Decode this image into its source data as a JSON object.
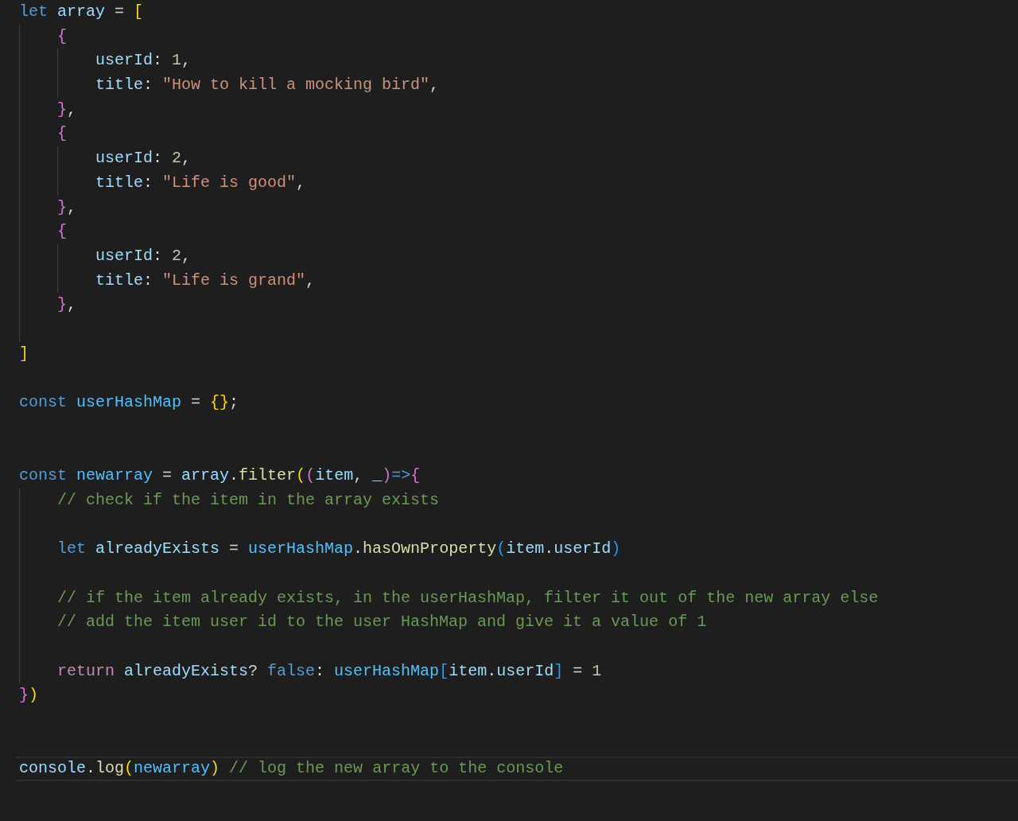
{
  "editor": {
    "lines": [
      {
        "kind": "code",
        "tokens": [
          {
            "kind": "keyword",
            "text": "let"
          },
          {
            "kind": "variable",
            "text": " array"
          },
          {
            "kind": "plain",
            "text": " = "
          },
          {
            "kind": "bracket_1",
            "text": "["
          }
        ],
        "children": [
          {
            "kind": "code",
            "tokens": [
              {
                "kind": "bracket_2",
                "text": "{"
              }
            ],
            "children": [
              {
                "kind": "code",
                "tokens": [
                  {
                    "kind": "variable",
                    "text": "userId"
                  },
                  {
                    "kind": "plain",
                    "text": ": "
                  },
                  {
                    "kind": "number",
                    "text": "1"
                  },
                  {
                    "kind": "plain",
                    "text": ","
                  }
                ]
              },
              {
                "kind": "code",
                "tokens": [
                  {
                    "kind": "variable",
                    "text": "title"
                  },
                  {
                    "kind": "plain",
                    "text": ": "
                  },
                  {
                    "kind": "string",
                    "text": "\"How to kill a mocking bird\""
                  },
                  {
                    "kind": "plain",
                    "text": ","
                  }
                ]
              }
            ]
          },
          {
            "kind": "code",
            "tokens": [
              {
                "kind": "bracket_2",
                "text": "}"
              },
              {
                "kind": "plain",
                "text": ","
              }
            ]
          },
          {
            "kind": "code",
            "tokens": [
              {
                "kind": "bracket_2",
                "text": "{"
              }
            ],
            "children": [
              {
                "kind": "code",
                "tokens": [
                  {
                    "kind": "variable",
                    "text": "userId"
                  },
                  {
                    "kind": "plain",
                    "text": ": "
                  },
                  {
                    "kind": "number",
                    "text": "2"
                  },
                  {
                    "kind": "plain",
                    "text": ","
                  }
                ]
              },
              {
                "kind": "code",
                "tokens": [
                  {
                    "kind": "variable",
                    "text": "title"
                  },
                  {
                    "kind": "plain",
                    "text": ": "
                  },
                  {
                    "kind": "string",
                    "text": "\"Life is good\""
                  },
                  {
                    "kind": "plain",
                    "text": ","
                  }
                ]
              }
            ]
          },
          {
            "kind": "code",
            "tokens": [
              {
                "kind": "bracket_2",
                "text": "}"
              },
              {
                "kind": "plain",
                "text": ","
              }
            ]
          },
          {
            "kind": "code",
            "tokens": [
              {
                "kind": "bracket_2",
                "text": "{"
              }
            ],
            "children": [
              {
                "kind": "code",
                "tokens": [
                  {
                    "kind": "variable",
                    "text": "userId"
                  },
                  {
                    "kind": "plain",
                    "text": ": "
                  },
                  {
                    "kind": "number",
                    "text": "2"
                  },
                  {
                    "kind": "plain",
                    "text": ","
                  }
                ]
              },
              {
                "kind": "code",
                "tokens": [
                  {
                    "kind": "variable",
                    "text": "title"
                  },
                  {
                    "kind": "plain",
                    "text": ": "
                  },
                  {
                    "kind": "string",
                    "text": "\"Life is grand\""
                  },
                  {
                    "kind": "plain",
                    "text": ","
                  }
                ]
              }
            ]
          },
          {
            "kind": "code",
            "tokens": [
              {
                "kind": "bracket_2",
                "text": "}"
              },
              {
                "kind": "plain",
                "text": ","
              }
            ]
          },
          {
            "kind": "blank"
          }
        ]
      },
      {
        "kind": "code",
        "tokens": [
          {
            "kind": "bracket_1",
            "text": "]"
          }
        ]
      },
      {
        "kind": "blank"
      },
      {
        "kind": "code",
        "tokens": [
          {
            "kind": "keyword",
            "text": "const"
          },
          {
            "kind": "constant",
            "text": " userHashMap"
          },
          {
            "kind": "plain",
            "text": " = "
          },
          {
            "kind": "bracket_1",
            "text": "{}"
          },
          {
            "kind": "plain",
            "text": ";"
          }
        ]
      },
      {
        "kind": "blank"
      },
      {
        "kind": "blank"
      },
      {
        "kind": "code",
        "tokens": [
          {
            "kind": "keyword",
            "text": "const"
          },
          {
            "kind": "constant",
            "text": " newarray"
          },
          {
            "kind": "plain",
            "text": " = "
          },
          {
            "kind": "variable",
            "text": "array"
          },
          {
            "kind": "plain",
            "text": "."
          },
          {
            "kind": "function",
            "text": "filter"
          },
          {
            "kind": "bracket_1",
            "text": "("
          },
          {
            "kind": "bracket_2",
            "text": "("
          },
          {
            "kind": "variable",
            "text": "item"
          },
          {
            "kind": "plain",
            "text": ", "
          },
          {
            "kind": "variable",
            "text": "_"
          },
          {
            "kind": "bracket_2",
            "text": ")"
          },
          {
            "kind": "keyword",
            "text": "=>"
          },
          {
            "kind": "bracket_2",
            "text": "{"
          }
        ],
        "children": [
          {
            "kind": "code",
            "tokens": [
              {
                "kind": "comment",
                "text": "// check if the item in the array exists"
              }
            ]
          },
          {
            "kind": "blank"
          },
          {
            "kind": "code",
            "tokens": [
              {
                "kind": "keyword",
                "text": "let"
              },
              {
                "kind": "variable",
                "text": " alreadyExists"
              },
              {
                "kind": "plain",
                "text": " = "
              },
              {
                "kind": "constant",
                "text": "userHashMap"
              },
              {
                "kind": "plain",
                "text": "."
              },
              {
                "kind": "function",
                "text": "hasOwnProperty"
              },
              {
                "kind": "bracket_3",
                "text": "("
              },
              {
                "kind": "variable",
                "text": "item"
              },
              {
                "kind": "plain",
                "text": "."
              },
              {
                "kind": "variable",
                "text": "userId"
              },
              {
                "kind": "bracket_3",
                "text": ")"
              }
            ]
          },
          {
            "kind": "blank"
          },
          {
            "kind": "code",
            "tokens": [
              {
                "kind": "comment",
                "text": "// if the item already exists, in the userHashMap, filter it out of the new array else"
              }
            ]
          },
          {
            "kind": "code",
            "tokens": [
              {
                "kind": "comment",
                "text": "// add the item user id to the user HashMap and give it a value of 1"
              }
            ]
          },
          {
            "kind": "blank"
          },
          {
            "kind": "code",
            "tokens": [
              {
                "kind": "control",
                "text": "return"
              },
              {
                "kind": "variable",
                "text": " alreadyExists"
              },
              {
                "kind": "plain",
                "text": "? "
              },
              {
                "kind": "keyword",
                "text": "false"
              },
              {
                "kind": "plain",
                "text": ": "
              },
              {
                "kind": "constant",
                "text": "userHashMap"
              },
              {
                "kind": "bracket_3",
                "text": "["
              },
              {
                "kind": "variable",
                "text": "item"
              },
              {
                "kind": "plain",
                "text": "."
              },
              {
                "kind": "variable",
                "text": "userId"
              },
              {
                "kind": "bracket_3",
                "text": "]"
              },
              {
                "kind": "plain",
                "text": " = "
              },
              {
                "kind": "number",
                "text": "1"
              }
            ]
          }
        ]
      },
      {
        "kind": "code",
        "tokens": [
          {
            "kind": "bracket_2",
            "text": "}"
          },
          {
            "kind": "bracket_1",
            "text": ")"
          }
        ]
      },
      {
        "kind": "blank"
      },
      {
        "kind": "blank"
      },
      {
        "kind": "code",
        "active": true,
        "tokens": [
          {
            "kind": "variable",
            "text": "console"
          },
          {
            "kind": "plain",
            "text": "."
          },
          {
            "kind": "function",
            "text": "log"
          },
          {
            "kind": "bracket_1",
            "text": "("
          },
          {
            "kind": "constant",
            "text": "newarray"
          },
          {
            "kind": "bracket_1",
            "text": ")"
          },
          {
            "kind": "comment",
            "text": " // log the new array to the console"
          }
        ]
      }
    ]
  }
}
